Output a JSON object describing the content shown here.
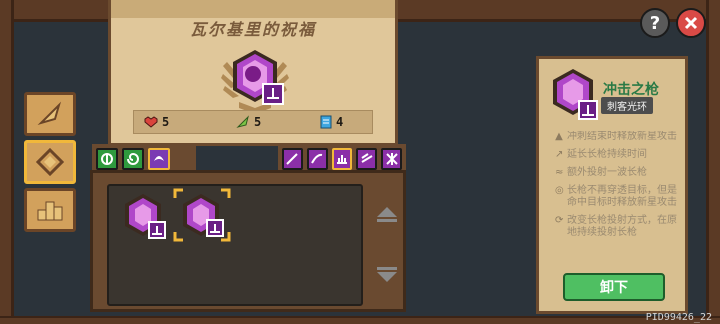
{
  "blessing": {
    "title": "瓦尔基里的祝福",
    "stats": [
      {
        "icon": "heart-icon",
        "value": "5",
        "color": "#d9443c"
      },
      {
        "icon": "leaf-icon",
        "value": "5",
        "color": "#7bc446"
      },
      {
        "icon": "card-icon",
        "value": "4",
        "color": "#3ea6e0"
      }
    ]
  },
  "side_tabs": [
    {
      "icon": "leaf-icon"
    },
    {
      "icon": "diamond-icon",
      "active": true
    },
    {
      "icon": "podium-icon"
    }
  ],
  "element_tabs": [
    {
      "icon": "nature-icon",
      "color": "#2f9a3e"
    },
    {
      "icon": "swirl-icon",
      "color": "#2f9a3e"
    },
    {
      "icon": "arcane-icon",
      "color": "#7b3bb3",
      "active": true
    }
  ],
  "skill_tabs": [
    {
      "icon": "lance-icon"
    },
    {
      "icon": "slash-icon"
    },
    {
      "icon": "pulse-icon",
      "active": true
    },
    {
      "icon": "dash-icon"
    },
    {
      "icon": "burst-icon"
    }
  ],
  "equipped": {
    "name": "冲击之枪",
    "tag": "刺客光环",
    "effects": [
      "冲刺结束时释放新星攻击",
      "延长长枪持续时间",
      "额外投射一波长枪",
      "长枪不再穿透目标，但是命中目标时释放新星攻击",
      "改变长枪投射方式，在原地持续投射长枪"
    ],
    "unload_label": "卸下"
  },
  "footer": {
    "pid": "PID99426_22"
  },
  "colors": {
    "accent": "#a73cd8",
    "gold": "#f1b83a",
    "green": "#4fbf62"
  }
}
